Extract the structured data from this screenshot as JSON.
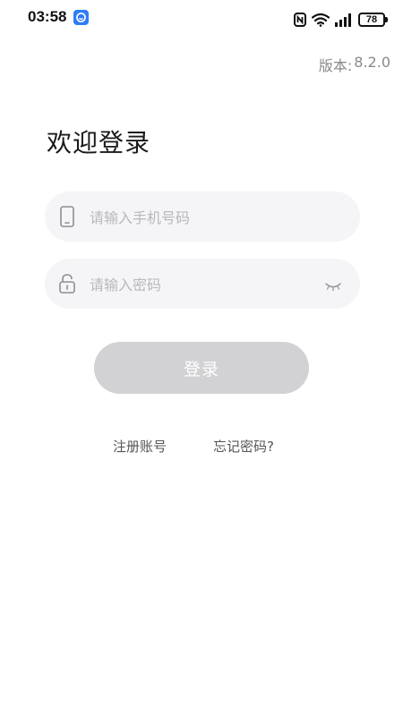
{
  "status_bar": {
    "time": "03:58",
    "battery": "78"
  },
  "version": {
    "label": "版本:",
    "value": "8.2.0"
  },
  "title": "欢迎登录",
  "phone_field": {
    "placeholder": "请输入手机号码",
    "value": ""
  },
  "password_field": {
    "placeholder": "请输入密码",
    "value": ""
  },
  "login_button": {
    "label": "登录",
    "color": "#d2d2d4"
  },
  "links": {
    "register": "注册账号",
    "forgot": "忘记密码?"
  }
}
